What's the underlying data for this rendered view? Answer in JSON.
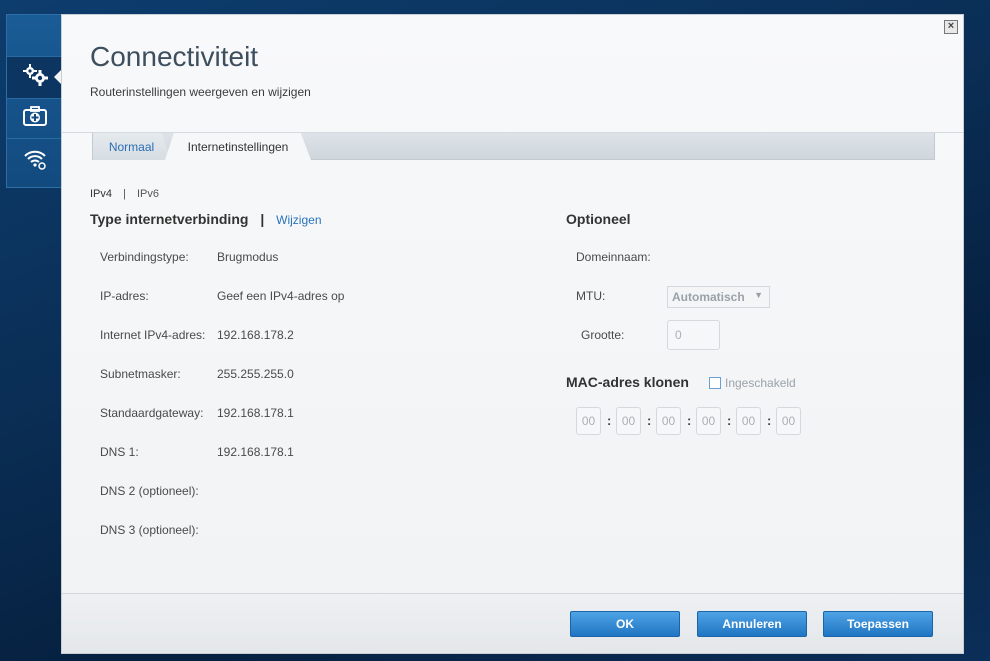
{
  "sidebar": {
    "items": [
      {
        "icon": "blank"
      },
      {
        "icon": "gears-icon",
        "active": true
      },
      {
        "icon": "medkit-icon"
      },
      {
        "icon": "wifi-gear-icon"
      }
    ]
  },
  "dialog": {
    "close_label": "×",
    "title": "Connectiviteit",
    "subtitle": "Routerinstellingen weergeven en wijzigen",
    "tabs": [
      {
        "label": "Normaal",
        "active": false
      },
      {
        "label": "Internetinstellingen",
        "active": true
      }
    ],
    "ip_versions": {
      "ipv4": "IPv4",
      "sep": "|",
      "ipv6": "IPv6"
    },
    "connection": {
      "title": "Type internetverbinding",
      "pipe": "|",
      "change_link": "Wijzigen",
      "rows": [
        {
          "label": "Verbindingstype:",
          "value": "Brugmodus"
        },
        {
          "label": "IP-adres:",
          "value": "Geef een IPv4-adres op"
        },
        {
          "label": "Internet IPv4-adres:",
          "value": "192.168.178.2"
        },
        {
          "label": "Subnetmasker:",
          "value": "255.255.255.0"
        },
        {
          "label": "Standaardgateway:",
          "value": "192.168.178.1"
        },
        {
          "label": "DNS 1:",
          "value": "192.168.178.1"
        },
        {
          "label": "DNS 2 (optioneel):",
          "value": ""
        },
        {
          "label": "DNS 3 (optioneel):",
          "value": ""
        }
      ]
    },
    "optional": {
      "title": "Optioneel",
      "domain_label": "Domeinnaam:",
      "mtu_label": "MTU:",
      "mtu_value": "Automatisch",
      "size_label": "Grootte:",
      "size_value": "0",
      "mac_title": "MAC-adres klonen",
      "mac_enabled_label": "Ingeschakeld",
      "mac_enabled": false,
      "mac_fields": [
        "00",
        "00",
        "00",
        "00",
        "00",
        "00"
      ],
      "mac_sep": ":"
    },
    "buttons": {
      "ok": "OK",
      "cancel": "Annuleren",
      "apply": "Toepassen"
    }
  },
  "colors": {
    "accent": "#2a73b8",
    "button": "#2a83d0",
    "background": "#0a2e55"
  }
}
